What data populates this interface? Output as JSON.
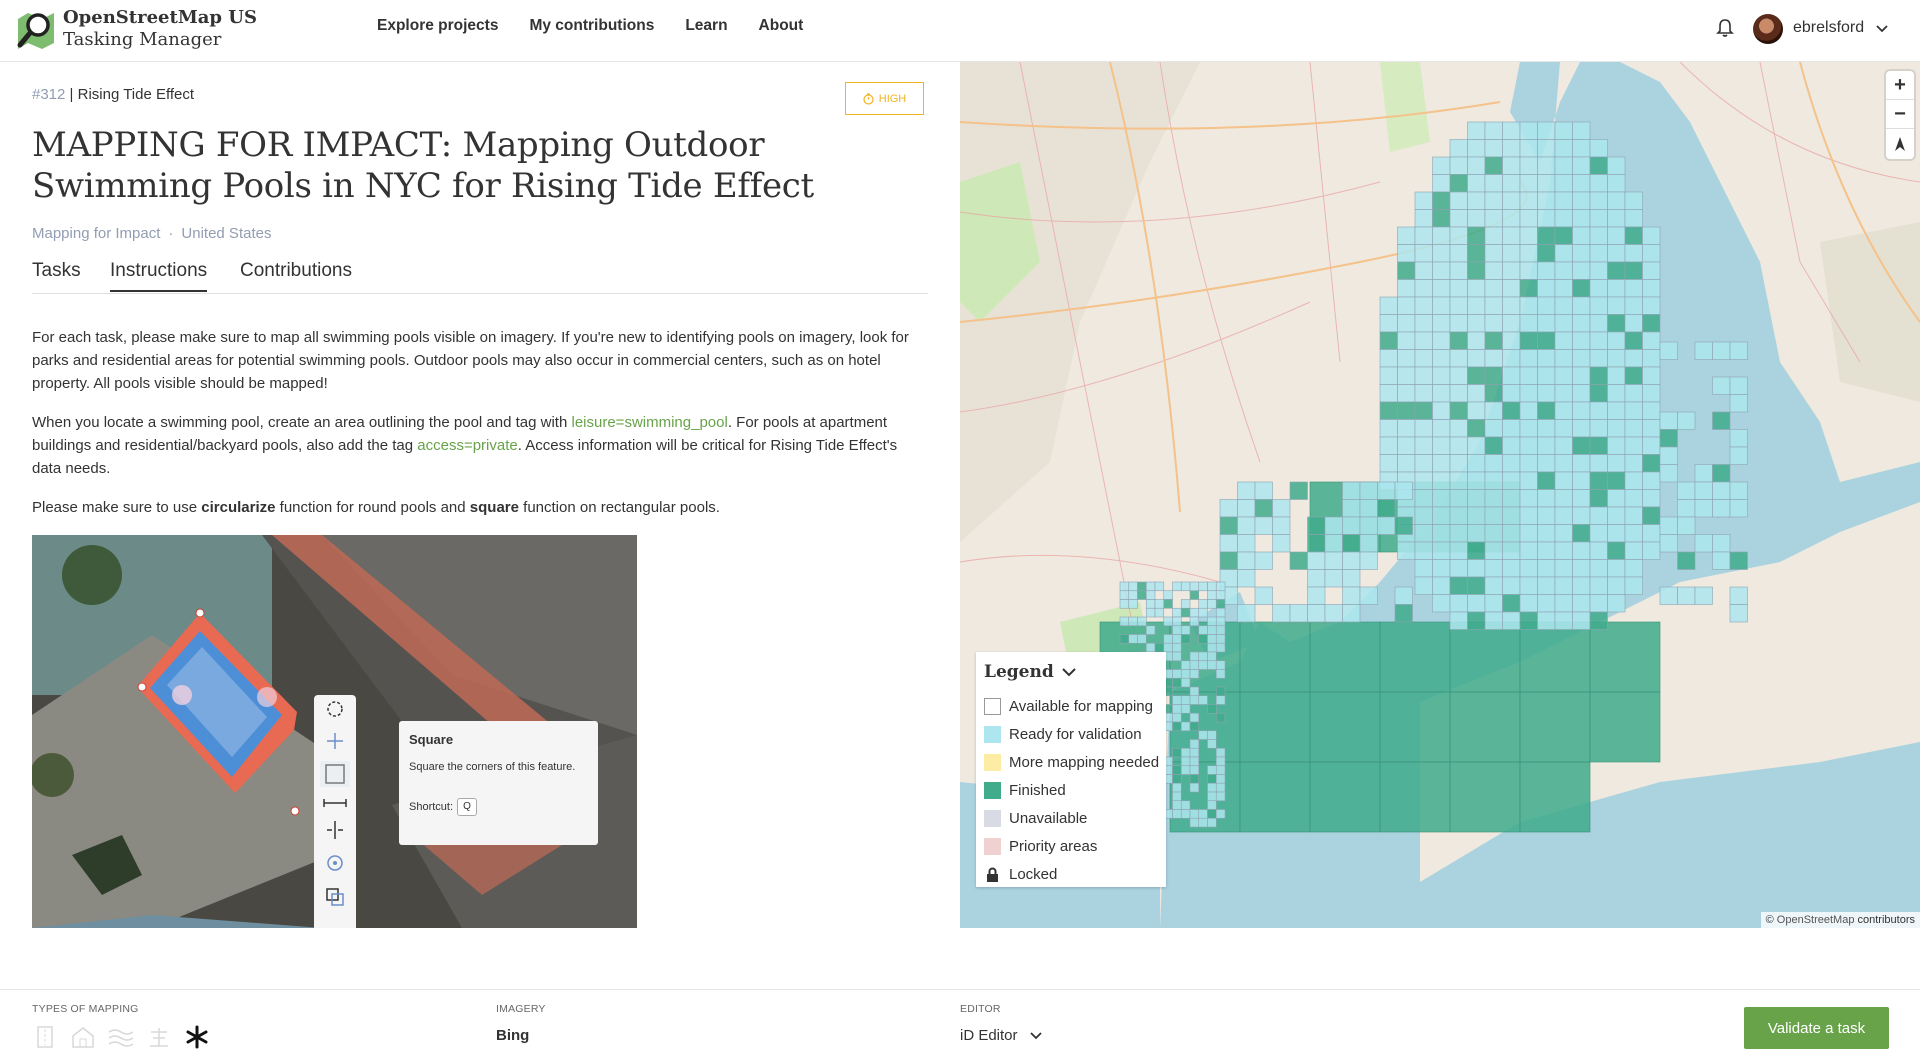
{
  "header": {
    "brand_line1": "OpenStreetMap US",
    "brand_line2": "Tasking Manager",
    "nav": [
      "Explore projects",
      "My contributions",
      "Learn",
      "About"
    ],
    "username": "ebrelsford"
  },
  "project": {
    "id": "#312",
    "org_name": "Rising Tide Effect",
    "priority": "HIGH",
    "title": "MAPPING FOR IMPACT: Mapping Outdoor Swimming Pools in NYC for Rising Tide Effect",
    "campaign": "Mapping for Impact",
    "country": "United States",
    "separator": "·"
  },
  "tabs": [
    "Tasks",
    "Instructions",
    "Contributions"
  ],
  "instructions": {
    "p1": "For each task, please make sure to map all swimming pools visible on imagery. If you're new to identifying pools on imagery, look for parks and residential areas for potential swimming pools. Outdoor pools may also occur in commercial centers, such as on hotel property. All pools visible should be mapped!",
    "p2_a": "When you locate a swimming pool, create an area outlining the pool and tag with ",
    "p2_tag1": "leisure=swimming_pool",
    "p2_b": ". For pools at apartment buildings and residential/backyard pools, also add the tag ",
    "p2_tag2": "access=private",
    "p2_c": ". Access information will be critical for Rising Tide Effect's data needs.",
    "p3_a": "Please make sure to use ",
    "p3_b1": "circularize",
    "p3_b": " function for round pools and ",
    "p3_b2": "square",
    "p3_c": " function on rectangular pools."
  },
  "tooltip": {
    "title": "Square",
    "desc": "Square the corners of this feature.",
    "shortcut_label": "Shortcut:",
    "shortcut_key": "Q"
  },
  "map": {
    "zoom_in": "+",
    "zoom_out": "−",
    "legend_title": "Legend",
    "legend": [
      {
        "label": "Available for mapping",
        "color": "#ffffff"
      },
      {
        "label": "Ready for validation",
        "color": "#ade6ef"
      },
      {
        "label": "More mapping needed",
        "color": "#fceca4"
      },
      {
        "label": "Finished",
        "color": "#40ac8c"
      },
      {
        "label": "Unavailable",
        "color": "#d8dae4"
      },
      {
        "label": "Priority areas",
        "color": "#efd1d1"
      },
      {
        "label": "Locked",
        "color": "lock-icon"
      }
    ],
    "attribution_prefix": "©",
    "attribution_link": "OpenStreetMap",
    "attribution_suffix": "contributors"
  },
  "footer": {
    "types_label": "TYPES OF MAPPING",
    "imagery_label": "IMAGERY",
    "imagery_value": "Bing",
    "editor_label": "EDITOR",
    "editor_value": "iD Editor",
    "action": "Validate a task"
  },
  "colors": {
    "accent_green": "#68a34a",
    "priority_orange": "#f0b323",
    "finished": "#40ac8c",
    "ready": "#ade6ef",
    "water": "#aad3df"
  }
}
